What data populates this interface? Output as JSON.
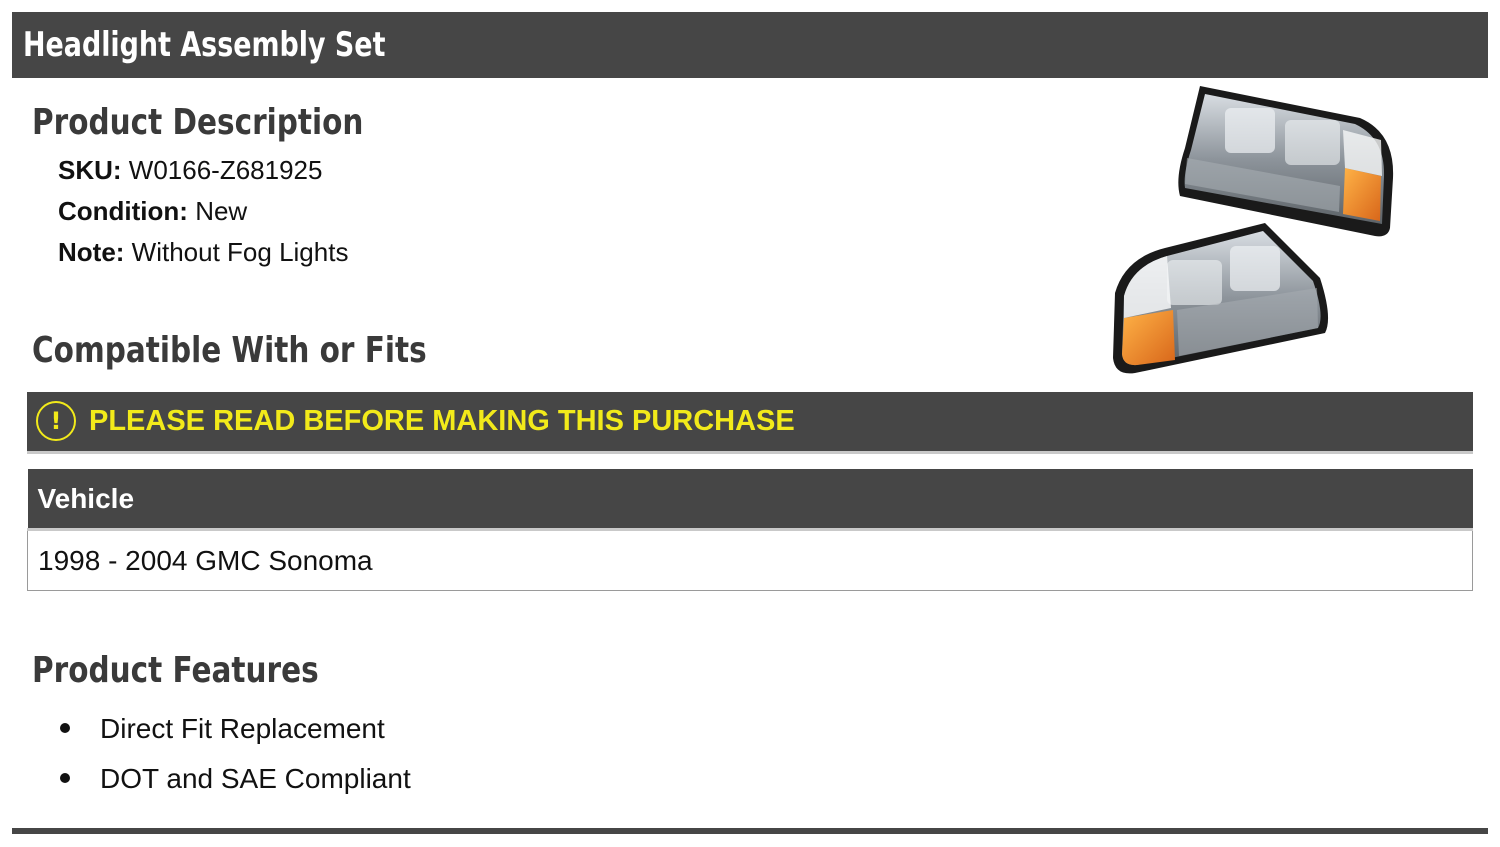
{
  "header": {
    "title": "Headlight Assembly Set"
  },
  "description": {
    "heading": "Product Description",
    "specs": [
      {
        "label": "SKU:",
        "value": "W0166-Z681925"
      },
      {
        "label": "Condition:",
        "value": "New"
      },
      {
        "label": "Note:",
        "value": "Without Fog Lights"
      }
    ]
  },
  "product_image": {
    "icon": "headlight-pair-image"
  },
  "compatibility": {
    "heading": "Compatible With or Fits",
    "warning": {
      "icon": "exclamation-circle-icon",
      "text": "PLEASE READ BEFORE MAKING THIS PURCHASE"
    },
    "table": {
      "columns": [
        "Vehicle"
      ],
      "rows": [
        [
          "1998 - 2004 GMC Sonoma"
        ]
      ]
    }
  },
  "features": {
    "heading": "Product Features",
    "items": [
      "Direct Fit Replacement",
      "DOT and SAE Compliant"
    ]
  },
  "colors": {
    "bar_background": "#464646",
    "warning_text": "#f2ea1a",
    "heading_text": "#3a3a3a"
  }
}
